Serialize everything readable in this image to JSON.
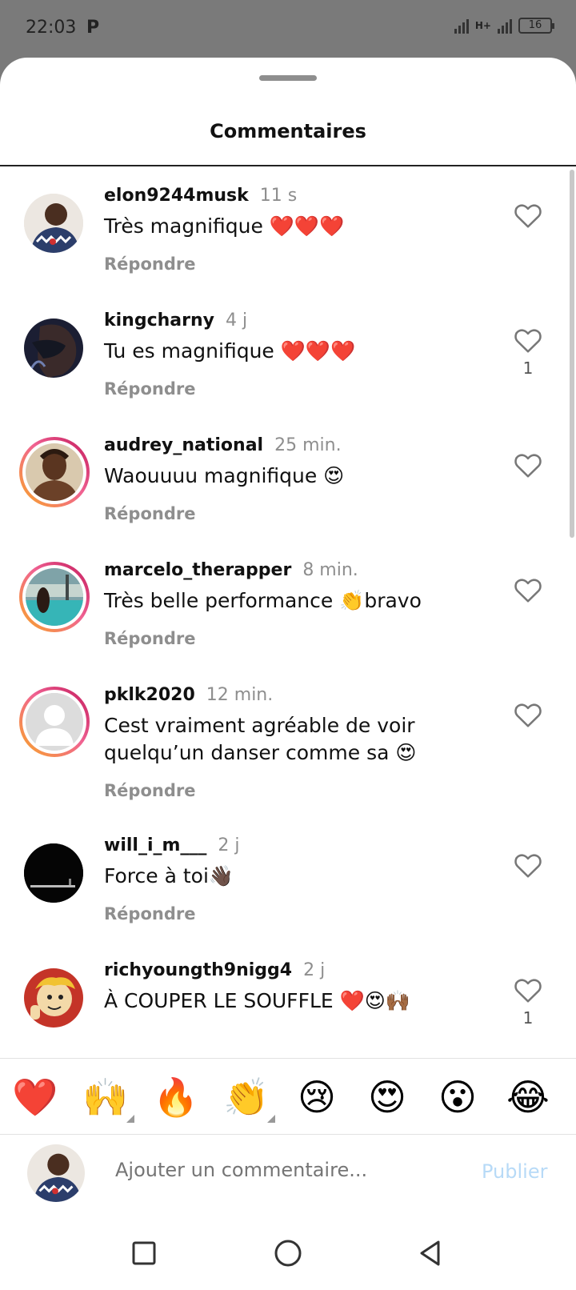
{
  "status_bar": {
    "time": "22:03",
    "app_icon": "P",
    "network": "H+",
    "battery": "16"
  },
  "sheet": {
    "title": "Commentaires"
  },
  "comments": [
    {
      "username": "elon9244musk",
      "time": "11 s",
      "text": "Très magnifique ❤️❤️❤️",
      "reply": "Répondre",
      "likes": ""
    },
    {
      "username": "kingcharny",
      "time": "4 j",
      "text": "Tu es magnifique ❤️❤️❤️",
      "reply": "Répondre",
      "likes": "1"
    },
    {
      "username": "audrey_national",
      "time": "25 min.",
      "text": "Waouuuu magnifique 😍",
      "reply": "Répondre",
      "likes": ""
    },
    {
      "username": "marcelo_therapper",
      "time": "8 min.",
      "text": "Très belle performance 👏bravo",
      "reply": "Répondre",
      "likes": ""
    },
    {
      "username": "pklk2020",
      "time": "12 min.",
      "text": "Cest vraiment agréable de voir quelqu’un danser comme sa 😍",
      "reply": "Répondre",
      "likes": ""
    },
    {
      "username": "will_i_m___",
      "time": "2 j",
      "text": "Force à toi👋🏿",
      "reply": "Répondre",
      "likes": ""
    },
    {
      "username": "richyoungth9nigg4",
      "time": "2 j",
      "text": "À COUPER LE SOUFFLE ❤️😍🙌🏾",
      "reply": "",
      "likes": "1"
    }
  ],
  "emoji_bar": [
    "❤️",
    "🙌",
    "🔥",
    "👏",
    "😢",
    "😍",
    "😮",
    "😂"
  ],
  "composer": {
    "placeholder": "Ajouter un commentaire...",
    "publish_label": "Publier"
  },
  "icons": {
    "like": "heart-outline-icon",
    "nav": [
      "recents-square-icon",
      "home-circle-icon",
      "back-triangle-icon"
    ]
  },
  "colors": {
    "ring_start": "#f9a825",
    "ring_end": "#c2185b",
    "publish": "#b7daf7",
    "meta_gray": "#8e8e8e"
  }
}
